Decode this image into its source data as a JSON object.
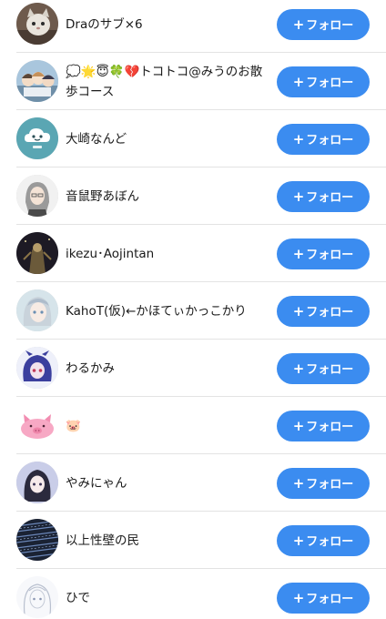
{
  "users": [
    {
      "name": "Draのサブ×6",
      "follow_label": "フォロー",
      "follow_prefix": "+",
      "avatar_icon": "cat-photo-avatar"
    },
    {
      "name": "💭🌟😇🍀💔トコトコ@みうのお散歩コース",
      "follow_label": "フォロー",
      "follow_prefix": "+",
      "avatar_icon": "anime-group-avatar"
    },
    {
      "name": "大崎なんど",
      "follow_label": "フォロー",
      "follow_prefix": "+",
      "avatar_icon": "cloud-face-avatar"
    },
    {
      "name": "音鼠野あぼん",
      "follow_label": "フォロー",
      "follow_prefix": "+",
      "avatar_icon": "gray-hair-character-avatar"
    },
    {
      "name": "ikezu･Aojintan",
      "follow_label": "フォロー",
      "follow_prefix": "+",
      "avatar_icon": "dark-figure-avatar"
    },
    {
      "name": "KahoT(仮)←かほてぃかっこかり",
      "follow_label": "フォロー",
      "follow_prefix": "+",
      "avatar_icon": "silver-hair-girl-avatar"
    },
    {
      "name": "わるかみ",
      "follow_label": "フォロー",
      "follow_prefix": "+",
      "avatar_icon": "purple-character-avatar"
    },
    {
      "name": "🐷",
      "follow_label": "フォロー",
      "follow_prefix": "+",
      "avatar_icon": "pink-pig-avatar"
    },
    {
      "name": "やみにゃん",
      "follow_label": "フォロー",
      "follow_prefix": "+",
      "avatar_icon": "dark-hair-girl-avatar"
    },
    {
      "name": "以上性壁の民",
      "follow_label": "フォロー",
      "follow_prefix": "+",
      "avatar_icon": "blue-digital-pattern-avatar"
    },
    {
      "name": "ひで",
      "follow_label": "フォロー",
      "follow_prefix": "+",
      "avatar_icon": "sketch-girl-avatar"
    }
  ],
  "colors": {
    "follow_button": "#3b8cf0",
    "follow_text": "#ffffff",
    "name_text": "#1a1a1a",
    "divider": "#e3e3e3"
  }
}
